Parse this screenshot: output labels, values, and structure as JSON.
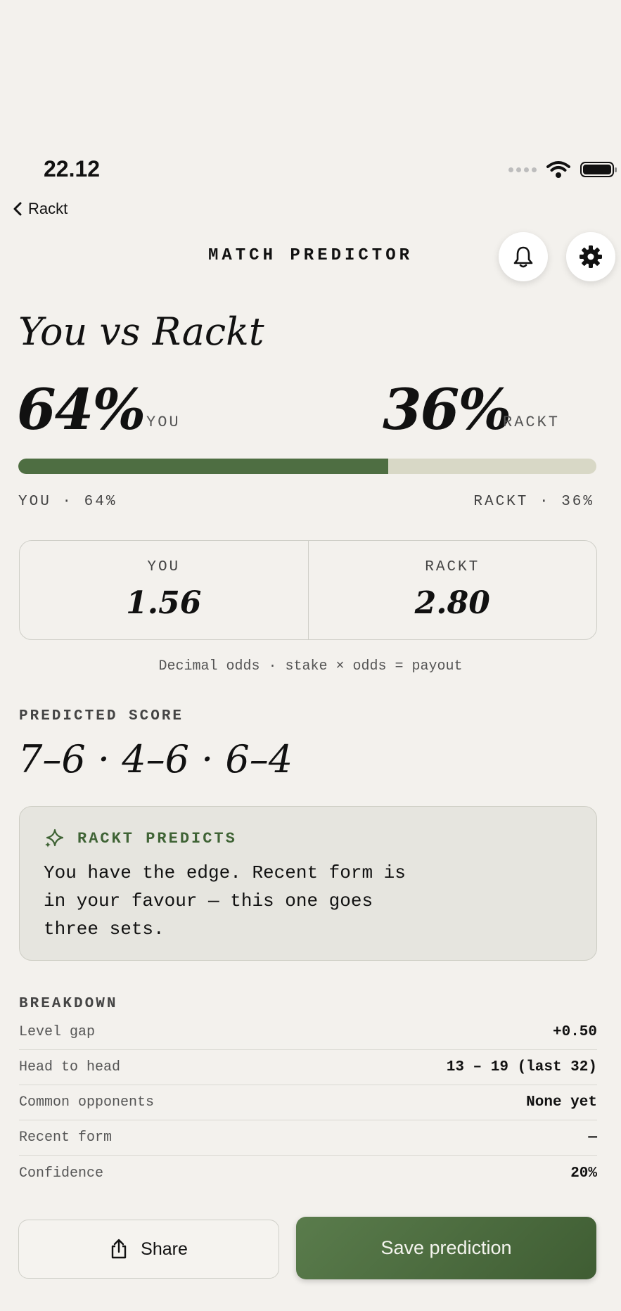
{
  "status_bar": {
    "time": "22.12"
  },
  "nav": {
    "back_label": "Rackt"
  },
  "header": {
    "title": "MATCH PREDICTOR"
  },
  "matchup": {
    "title": "You vs Rackt"
  },
  "probability": {
    "you_pct": "64%",
    "you_label": "YOU",
    "rackt_pct": "36%",
    "rackt_label": "RACKT",
    "you_fraction": 0.64,
    "caption_you": "YOU · 64%",
    "caption_rackt": "RACKT · 36%"
  },
  "odds": {
    "you_label": "YOU",
    "you_value": "1.56",
    "rackt_label": "RACKT",
    "rackt_value": "2.80",
    "note": "Decimal odds · stake × odds = payout"
  },
  "predicted_score": {
    "label": "PREDICTED SCORE",
    "value": "7–6 · 4–6 · 6–4"
  },
  "rackt_predicts": {
    "title": "RACKT PREDICTS",
    "text": "You have the edge. Recent form is in your favour — this one goes three sets."
  },
  "breakdown": {
    "label": "BREAKDOWN",
    "rows": [
      {
        "label": "Level gap",
        "value": "+0.50"
      },
      {
        "label": "Head to head",
        "value": "13 – 19 (last 32)"
      },
      {
        "label": "Common opponents",
        "value": "None yet"
      },
      {
        "label": "Recent form",
        "value": "—"
      },
      {
        "label": "Confidence",
        "value": "20%"
      }
    ]
  },
  "actions": {
    "share_label": "Share",
    "save_label": "Save prediction"
  },
  "colors": {
    "accent": "#4e6e42",
    "bar_track": "#d8d8c6",
    "background": "#f3f1ed"
  },
  "icons": [
    "chevron-left-icon",
    "bell-icon",
    "gear-icon",
    "sparkle-icon",
    "share-icon",
    "wifi-icon",
    "battery-icon",
    "signal-icon"
  ]
}
